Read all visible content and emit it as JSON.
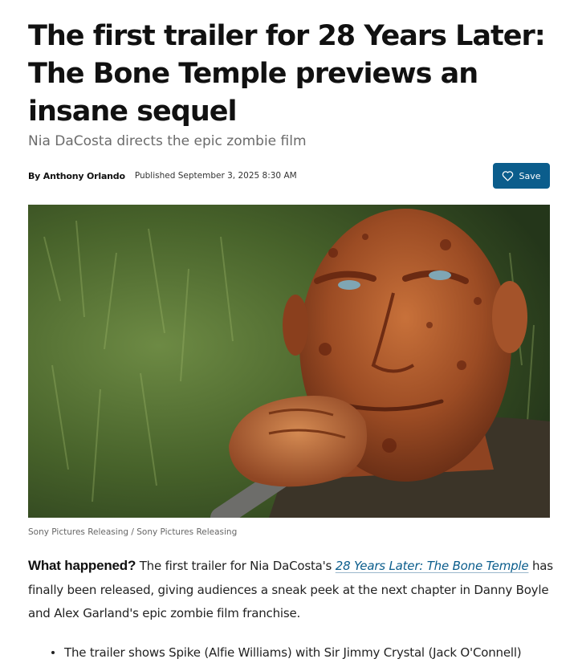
{
  "article": {
    "headline": "The first trailer for 28 Years Later: The Bone Temple previews an insane sequel",
    "subheadline": "Nia DaCosta directs the epic zombie film",
    "byline": "By Anthony Orlando",
    "published": "Published September 3, 2025 8:30 AM",
    "save_label": "Save",
    "image_credit": "Sony Pictures Releasing / Sony Pictures Releasing",
    "body": {
      "lead": "What happened?",
      "text_before_link": " The first trailer for Nia DaCosta's ",
      "link_text": "28 Years Later: The Bone Temple",
      "text_after_link": " has finally been released, giving audiences a sneak peek at the next chapter in Danny Boyle and Alex Garland's epic zombie film franchise."
    },
    "bullets": [
      "The trailer shows Spike (Alfie Williams) with Sir Jimmy Crystal (Jack O'Connell)"
    ]
  },
  "colors": {
    "accent": "#0b5d8c",
    "subhead": "#6b6b6b"
  },
  "icons": {
    "save": "heart-icon"
  }
}
